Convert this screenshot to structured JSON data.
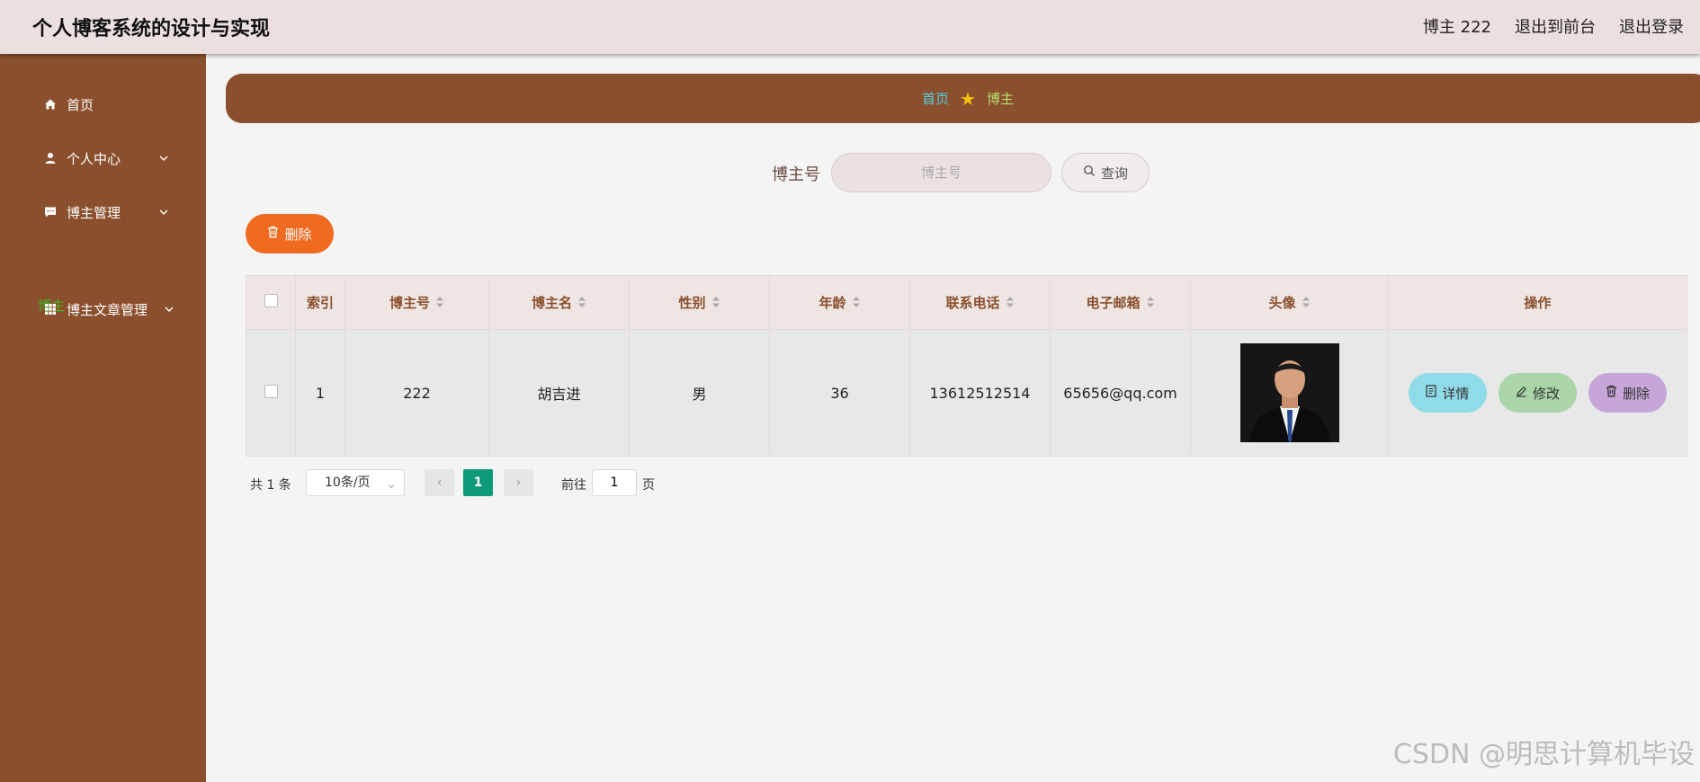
{
  "header": {
    "title": "个人博客系统的设计与实现",
    "user": "博主 222",
    "to_front": "退出到前台",
    "logout": "退出登录"
  },
  "sidebar": {
    "items": [
      {
        "label": "首页",
        "icon": "home-icon"
      },
      {
        "label": "个人中心",
        "icon": "user-icon"
      },
      {
        "label": "博主管理",
        "icon": "chat-icon"
      },
      {
        "label": "博主文章管理",
        "icon": "grid-icon"
      }
    ],
    "sub_active": "博主"
  },
  "breadcrumb": {
    "home": "首页",
    "current": "博主"
  },
  "search": {
    "label": "博主号",
    "placeholder": "博主号",
    "button": "查询"
  },
  "actions": {
    "delete": "删除"
  },
  "table": {
    "columns": [
      "索引",
      "博主号",
      "博主名",
      "性别",
      "年龄",
      "联系电话",
      "电子邮箱",
      "头像",
      "操作"
    ],
    "rows": [
      {
        "index": "1",
        "id": "222",
        "name": "胡吉进",
        "gender": "男",
        "age": "36",
        "phone": "13612512514",
        "email": "65656@qq.com"
      }
    ],
    "row_actions": {
      "detail": "详情",
      "edit": "修改",
      "delete": "删除"
    }
  },
  "pager": {
    "total": "共 1 条",
    "page_size": "10条/页",
    "current": "1",
    "goto_label": "前往",
    "goto_value": "1",
    "page_unit": "页"
  },
  "watermark": "CSDN @明思计算机毕设",
  "colors": {
    "sidebar": "#8a4f2d",
    "header": "#ebdfdf",
    "accent_orange": "#f06a20",
    "pager_active": "#0e9a79"
  }
}
